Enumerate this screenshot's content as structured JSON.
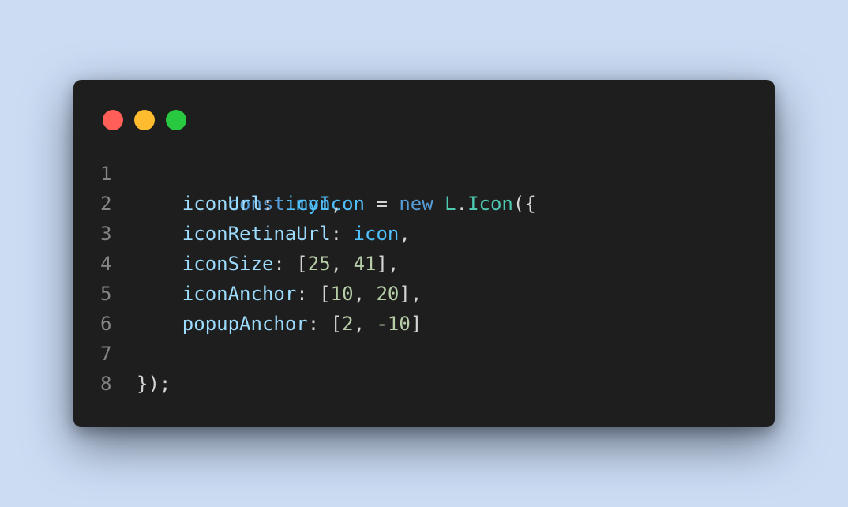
{
  "window_controls": {
    "close_color": "#ff5f57",
    "minimize_color": "#febc2e",
    "maximize_color": "#28c840"
  },
  "code": {
    "line_numbers": [
      "1",
      "2",
      "3",
      "4",
      "5",
      "6",
      "7",
      "8"
    ],
    "line1": {
      "keyword_const": "const",
      "var_name": "myIcon",
      "eq": " = ",
      "keyword_new": "new",
      "namespace": "L",
      "dot": ".",
      "class_name": "Icon",
      "open": "({"
    },
    "line2": {
      "key": "iconUrl",
      "colon": ": ",
      "value": "icon",
      "end": ","
    },
    "line3": {
      "key": "iconRetinaUrl",
      "colon": ": ",
      "value": "icon",
      "end": ","
    },
    "line4": {
      "key": "iconSize",
      "colon": ": [",
      "n1": "25",
      "sep": ", ",
      "n2": "41",
      "end": "],"
    },
    "line5": {
      "key": "iconAnchor",
      "colon": ": [",
      "n1": "10",
      "sep": ", ",
      "n2": "20",
      "end": "],"
    },
    "line6": {
      "key": "popupAnchor",
      "colon": ": [",
      "n1": "2",
      "sep": ", ",
      "n2": "-10",
      "end": "]"
    },
    "line8": {
      "close": "});"
    }
  }
}
